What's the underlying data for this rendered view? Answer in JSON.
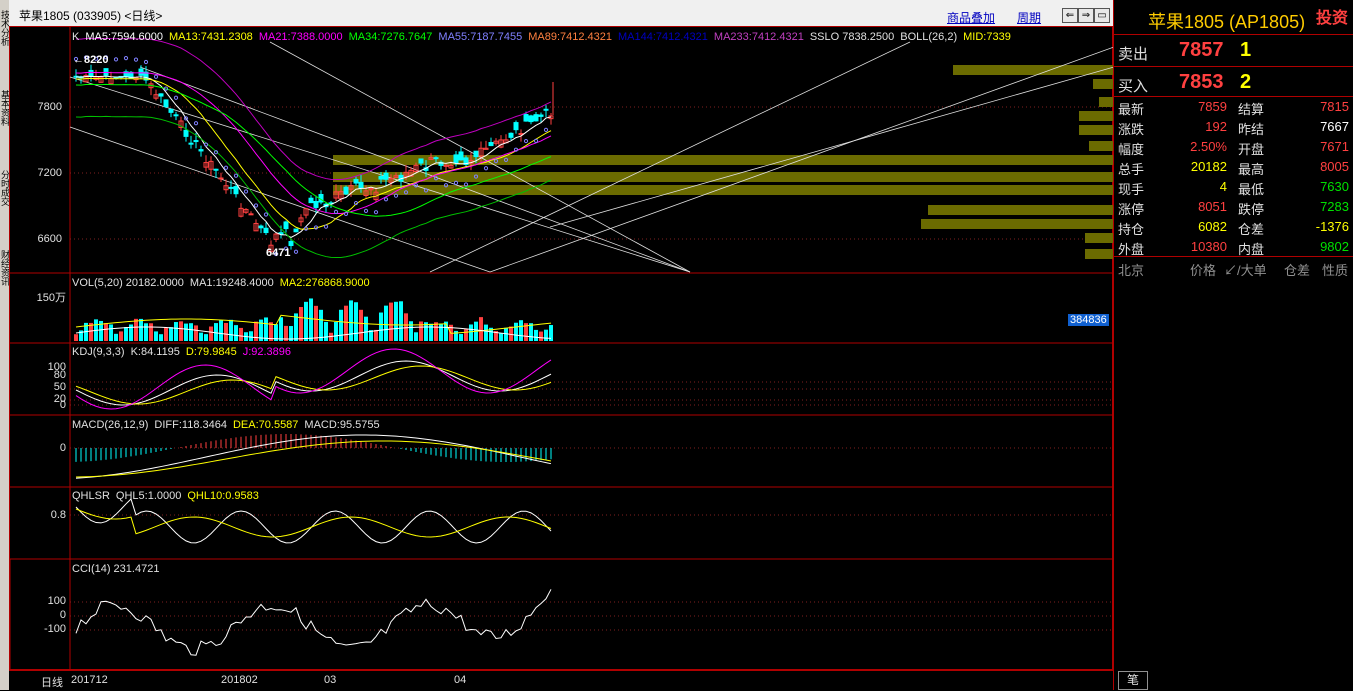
{
  "window": {
    "title": "苹果1805 (033905) <日线>",
    "links": [
      "商品叠加",
      "周期"
    ],
    "buttons": [
      "⇐",
      "⇒",
      "▭"
    ]
  },
  "left_tabs": [
    "技术分析",
    "基本资料",
    "分时成交",
    "财经资讯"
  ],
  "main_panel": {
    "legend_prefix": "K",
    "ma_items": [
      {
        "text": "MA5:7594.6000",
        "color": "#ffffff"
      },
      {
        "text": "MA13:7431.2308",
        "color": "#ffff00"
      },
      {
        "text": "MA21:7388.0000",
        "color": "#ff00ff"
      },
      {
        "text": "MA34:7276.7647",
        "color": "#00ff00"
      },
      {
        "text": "MA55:7187.7455",
        "color": "#8080ff"
      },
      {
        "text": "MA89:7412.4321",
        "color": "#ff8040"
      },
      {
        "text": "MA144:7412.4321",
        "color": "#0000c0"
      },
      {
        "text": "MA233:7412.4321",
        "color": "#c040c0"
      },
      {
        "text": "SSLO 7838.2500",
        "color": "#e0e0e0"
      },
      {
        "text": "BOLL(26,2)",
        "color": "#e0e0e0"
      },
      {
        "text": "MID:7339",
        "color": "#ffff00"
      }
    ],
    "y_ticks": [
      "7800",
      "7200",
      "6600"
    ],
    "high_marker": "←8220",
    "low_marker": "6471",
    "vol_box": "384836"
  },
  "vol_panel": {
    "items": [
      {
        "text": "VOL(5,20) 20182.0000",
        "color": "#e0e0e0"
      },
      {
        "text": "MA1:19248.4000",
        "color": "#e0e0e0"
      },
      {
        "text": "MA2:276868.9000",
        "color": "#ffff00"
      }
    ],
    "y_tick": "150万"
  },
  "kdj_panel": {
    "items": [
      {
        "text": "KDJ(9,3,3)",
        "color": "#e0e0e0"
      },
      {
        "text": "K:84.1195",
        "color": "#e0e0e0"
      },
      {
        "text": "D:79.9845",
        "color": "#ffff00"
      },
      {
        "text": "J:92.3896",
        "color": "#ff00ff"
      }
    ],
    "y_ticks": [
      "100",
      "80",
      "50",
      "20",
      "0"
    ]
  },
  "macd_panel": {
    "items": [
      {
        "text": "MACD(26,12,9)",
        "color": "#e0e0e0"
      },
      {
        "text": "DIFF:118.3464",
        "color": "#e0e0e0"
      },
      {
        "text": "DEA:70.5587",
        "color": "#ffff00"
      },
      {
        "text": "MACD:95.5755",
        "color": "#e0e0e0"
      }
    ],
    "y_tick": "0"
  },
  "qhlsr_panel": {
    "items": [
      {
        "text": "QHLSR",
        "color": "#e0e0e0"
      },
      {
        "text": "QHL5:1.0000",
        "color": "#e0e0e0"
      },
      {
        "text": "QHL10:0.9583",
        "color": "#ffff00"
      }
    ],
    "y_tick": "0.8"
  },
  "cci_panel": {
    "items": [
      {
        "text": "CCI(14) 231.4721",
        "color": "#e0e0e0"
      }
    ],
    "y_ticks": [
      "100",
      "0",
      "-100"
    ]
  },
  "x_axis": {
    "label": "日线",
    "ticks": [
      "201712",
      "201802",
      "03",
      "04"
    ]
  },
  "quote": {
    "name": "苹果1805 (AP1805)",
    "logo": "投资",
    "sell_label": "卖出",
    "sell_price": "7857",
    "sell_qty": "1",
    "buy_label": "买入",
    "buy_price": "7853",
    "buy_qty": "2",
    "rows": [
      {
        "k1": "最新",
        "v1": "7859",
        "c1": "red",
        "k2": "结算",
        "v2": "7815",
        "c2": "red"
      },
      {
        "k1": "涨跌",
        "v1": "192",
        "c1": "red",
        "k2": "昨结",
        "v2": "7667",
        "c2": "white"
      },
      {
        "k1": "幅度",
        "v1": "2.50%",
        "c1": "red",
        "k2": "开盘",
        "v2": "7671",
        "c2": "red"
      },
      {
        "k1": "总手",
        "v1": "20182",
        "c1": "yellow",
        "k2": "最高",
        "v2": "8005",
        "c2": "red"
      },
      {
        "k1": "现手",
        "v1": "4",
        "c1": "yellow",
        "k2": "最低",
        "v2": "7630",
        "c2": "green"
      },
      {
        "k1": "涨停",
        "v1": "8051",
        "c1": "red",
        "k2": "跌停",
        "v2": "7283",
        "c2": "green"
      },
      {
        "k1": "持仓",
        "v1": "6082",
        "c1": "yellow",
        "k2": "仓差",
        "v2": "-1376",
        "c2": "yellow"
      },
      {
        "k1": "外盘",
        "v1": "10380",
        "c1": "red",
        "k2": "内盘",
        "v2": "9802",
        "c2": "green"
      }
    ],
    "trade_headers": [
      "北京",
      "价格",
      "↙/大单",
      "仓差",
      "性质"
    ],
    "bottom_tab": "笔"
  },
  "colors": {
    "up": "#ff4040",
    "down": "#00ffff",
    "frame": "#b00000",
    "volume_profile": "#6b6b00"
  }
}
